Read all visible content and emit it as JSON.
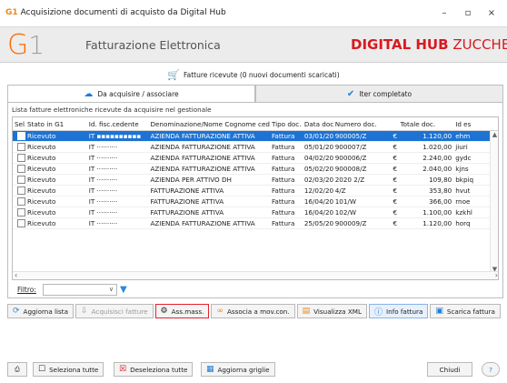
{
  "window": {
    "title": "Acquisizione documenti di acquisto da Digital Hub",
    "app_icon": "G1",
    "controls": {
      "minimize": "–",
      "maximize": "▫",
      "close": "×"
    }
  },
  "brand": {
    "logo_g": "G",
    "logo_1": "1",
    "module_title": "Fatturazione Elettronica",
    "right_bold": "DIGITAL HUB",
    "right_regular": "ZUCCHETTI"
  },
  "status": {
    "text": "Fatture ricevute (0 nuovi documenti scaricati)",
    "icon": "cart-icon"
  },
  "tabs": [
    {
      "label": "Da acquisire / associare",
      "icon": "download-cloud-icon",
      "active": true
    },
    {
      "label": "Iter completato",
      "icon": "checkmark-icon",
      "active": false
    }
  ],
  "panel": {
    "caption": "Lista fatture elettroniche ricevute da acquisire nel gestionale"
  },
  "table": {
    "columns": [
      "Sel.",
      "Stato in G1",
      "Id. fisc.cedente",
      "Denominazione/Nome Cognome ced.",
      "Tipo doc.",
      "Data doc.",
      "Numero doc.",
      "Totale doc.",
      "",
      "Id es"
    ],
    "rows": [
      {
        "stato": "Ricevuto",
        "id": "IT ▪▪▪▪▪▪▪▪▪▪",
        "den": "AZIENDA FATTURAZIONE ATTIVA",
        "tipo": "Fattura",
        "data": "03/01/20",
        "num": "900005/Z",
        "eur": "€",
        "tot": "1.120,00",
        "ides": "ehm",
        "selected": true
      },
      {
        "stato": "Ricevuto",
        "id": "IT ··········",
        "den": "AZIENDA FATTURAZIONE ATTIVA",
        "tipo": "Fattura",
        "data": "05/01/20",
        "num": "900007/Z",
        "eur": "€",
        "tot": "1.020,00",
        "ides": "jiuri",
        "selected": false
      },
      {
        "stato": "Ricevuto",
        "id": "IT ··········",
        "den": "AZIENDA FATTURAZIONE ATTIVA",
        "tipo": "Fattura",
        "data": "04/02/20",
        "num": "900006/Z",
        "eur": "€",
        "tot": "2.240,00",
        "ides": "gydc",
        "selected": false
      },
      {
        "stato": "Ricevuto",
        "id": "IT ··········",
        "den": "AZIENDA FATTURAZIONE ATTIVA",
        "tipo": "Fattura",
        "data": "05/02/20",
        "num": "900008/Z",
        "eur": "€",
        "tot": "2.040,00",
        "ides": "kjns",
        "selected": false
      },
      {
        "stato": "Ricevuto",
        "id": "IT ··········",
        "den": "AZIENDA PER ATTIVO DH",
        "tipo": "Fattura",
        "data": "02/03/20",
        "num": "2020    2/Z",
        "eur": "€",
        "tot": "109,80",
        "ides": "bkpiq",
        "selected": false
      },
      {
        "stato": "Ricevuto",
        "id": "IT ··········",
        "den": "FATTURAZIONE ATTIVA",
        "tipo": "Fattura",
        "data": "12/02/20",
        "num": "4/Z",
        "eur": "€",
        "tot": "353,80",
        "ides": "hvut",
        "selected": false
      },
      {
        "stato": "Ricevuto",
        "id": "IT ··········",
        "den": "FATTURAZIONE ATTIVA",
        "tipo": "Fattura",
        "data": "16/04/20",
        "num": "101/W",
        "eur": "€",
        "tot": "366,00",
        "ides": "rnoe",
        "selected": false
      },
      {
        "stato": "Ricevuto",
        "id": "IT ··········",
        "den": "FATTURAZIONE ATTIVA",
        "tipo": "Fattura",
        "data": "16/04/20",
        "num": "102/W",
        "eur": "€",
        "tot": "1.100,00",
        "ides": "kzkhl",
        "selected": false
      },
      {
        "stato": "Ricevuto",
        "id": "IT ··········",
        "den": "AZIENDA FATTURAZIONE ATTIVA",
        "tipo": "Fattura",
        "data": "25/05/20",
        "num": "900009/Z",
        "eur": "€",
        "tot": "1.120,00",
        "ides": "horq",
        "selected": false
      }
    ]
  },
  "filter": {
    "label": "Filtro:",
    "value": ""
  },
  "actions": {
    "aggiorna_lista": "Aggiorna lista",
    "acquisisci_fatture": "Acquisisci fatture",
    "ass_mass": "Ass.mass.",
    "associa_mov": "Associa a mov.con.",
    "visualizza_xml": "Visualizza XML",
    "info_fattura": "Info fattura",
    "scarica_fattura": "Scarica fattura"
  },
  "bottom": {
    "seleziona_tutte": "Seleziona tutte",
    "deseleziona_tutte": "Deseleziona tutte",
    "aggiorna_griglie": "Aggiorna griglie",
    "chiudi": "Chiudi",
    "help": "?"
  },
  "colors": {
    "selection": "#1d73d3",
    "brand_red": "#d71920",
    "logo_orange": "#ff6a00",
    "highlight_border": "#e0232f"
  }
}
